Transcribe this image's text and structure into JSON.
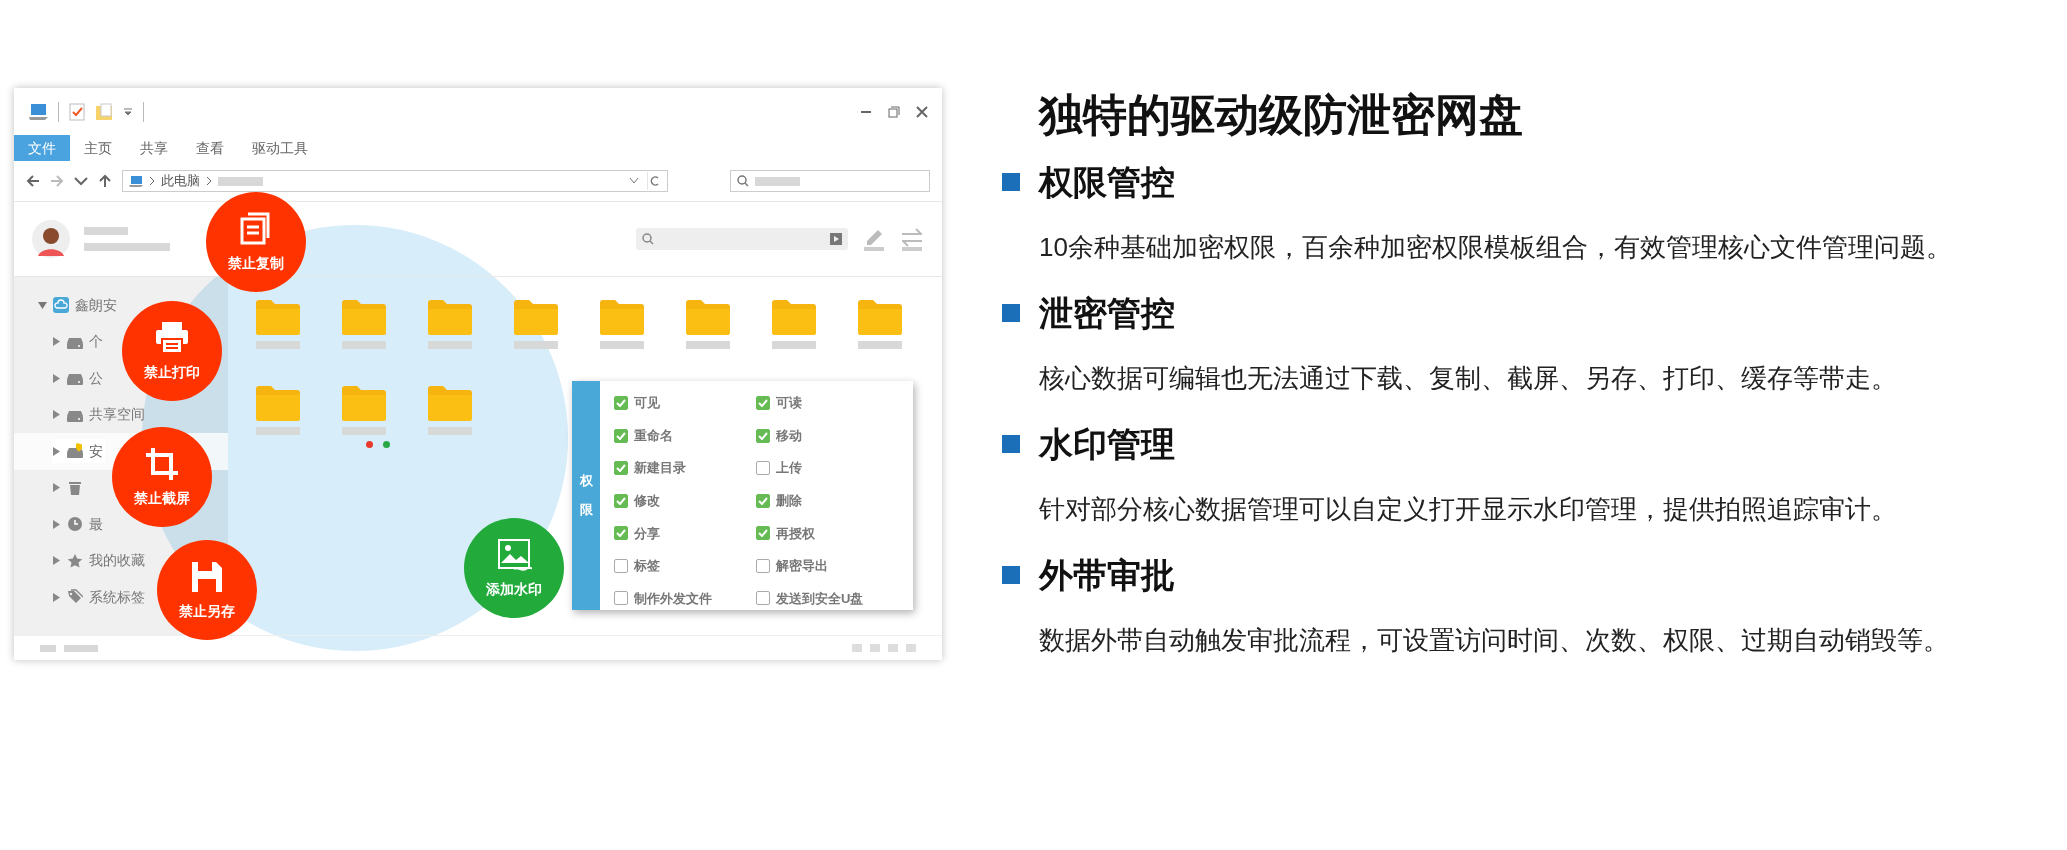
{
  "window": {
    "ribbon_tabs": [
      {
        "label": "文件",
        "selected": true
      },
      {
        "label": "主页",
        "selected": false
      },
      {
        "label": "共享",
        "selected": false
      },
      {
        "label": "查看",
        "selected": false
      },
      {
        "label": "驱动工具",
        "selected": false
      }
    ],
    "address": {
      "location": "此电脑"
    },
    "sidebar": {
      "items": [
        {
          "label": "鑫朗安",
          "kind": "cloud",
          "expanded": true,
          "selected": false,
          "children": [
            {
              "label": "个",
              "kind": "drive",
              "expanded": false,
              "selected": false
            },
            {
              "label": "公",
              "kind": "drive",
              "expanded": false,
              "selected": false
            },
            {
              "label": "共享空间",
              "kind": "drive",
              "expanded": false,
              "selected": false
            },
            {
              "label": "安",
              "kind": "secure-drive",
              "expanded": false,
              "selected": true
            },
            {
              "kind": "trash",
              "expanded": false,
              "selected": false
            },
            {
              "label": "最",
              "kind": "clock",
              "expanded": false,
              "selected": false
            },
            {
              "label": "我的收藏",
              "kind": "star",
              "expanded": false,
              "selected": false
            },
            {
              "label": "系统标签",
              "kind": "tag",
              "expanded": false,
              "selected": false
            }
          ]
        }
      ]
    },
    "folders": [
      {
        "kind": "folder"
      },
      {
        "kind": "folder"
      },
      {
        "kind": "folder"
      },
      {
        "kind": "folder"
      },
      {
        "kind": "folder"
      },
      {
        "kind": "folder"
      },
      {
        "kind": "folder"
      },
      {
        "kind": "folder"
      },
      {
        "kind": "folder"
      },
      {
        "kind": "folder"
      },
      {
        "kind": "folder"
      }
    ],
    "page_dots": [
      {
        "color": "#e8392b"
      },
      {
        "color": "#27a844"
      }
    ],
    "badges": [
      {
        "label": "禁止复制",
        "kind": "copy",
        "color": "#ff3300"
      },
      {
        "label": "禁止打印",
        "kind": "print",
        "color": "#ff3300"
      },
      {
        "label": "禁止截屏",
        "kind": "crop",
        "color": "#ff3300"
      },
      {
        "label": "禁止另存",
        "kind": "save",
        "color": "#ff3300"
      },
      {
        "label": "添加水印",
        "kind": "watermark",
        "color": "#22aa3a"
      }
    ],
    "permissions": {
      "title": "权限",
      "items": [
        {
          "label": "可见",
          "checked": true
        },
        {
          "label": "可读",
          "checked": true
        },
        {
          "label": "重命名",
          "checked": true
        },
        {
          "label": "移动",
          "checked": true
        },
        {
          "label": "新建目录",
          "checked": true
        },
        {
          "label": "上传",
          "checked": false
        },
        {
          "label": "修改",
          "checked": true
        },
        {
          "label": "删除",
          "checked": true
        },
        {
          "label": "分享",
          "checked": true
        },
        {
          "label": "再授权",
          "checked": true
        },
        {
          "label": "标签",
          "checked": false
        },
        {
          "label": "解密导出",
          "checked": false
        },
        {
          "label": "制作外发文件",
          "checked": false
        },
        {
          "label": "发送到安全U盘",
          "checked": false
        }
      ]
    }
  },
  "headline": "独特的驱动级防泄密网盘",
  "features": [
    {
      "title": "权限管控",
      "text": "10余种基础加密权限，百余种加密权限模板组合，有效管理核心文件管理问题。"
    },
    {
      "title": "泄密管控",
      "text": "核心数据可编辑也无法通过下载、复制、截屏、另存、打印、缓存等带走。"
    },
    {
      "title": "水印管理",
      "text": "针对部分核心数据管理可以自定义打开显示水印管理，提供拍照追踪审计。"
    },
    {
      "title": "外带审批",
      "text": "数据外带自动触发审批流程，可设置访问时间、次数、权限、过期自动销毁等。"
    }
  ]
}
